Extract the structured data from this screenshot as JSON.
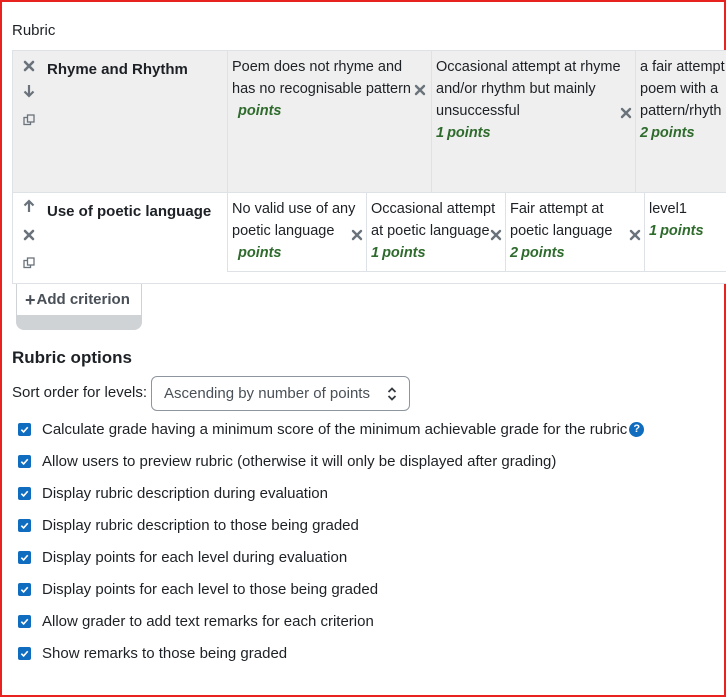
{
  "section_label": "Rubric",
  "criteria": [
    {
      "description": "Rhyme and Rhythm",
      "levels": [
        {
          "definition": [
            "Poem does not rhyme and",
            "has no recognisable pattern"
          ],
          "score": "",
          "points_word": "points"
        },
        {
          "definition": [
            "Occasional attempt at rhyme",
            "and/or rhythm but mainly",
            "unsuccessful"
          ],
          "score": "1",
          "points_word": "points"
        },
        {
          "definition": [
            "a fair attempt",
            "poem with a",
            "pattern/rhyth"
          ],
          "score": "2",
          "points_word": "points"
        }
      ]
    },
    {
      "description": "Use of poetic language",
      "levels": [
        {
          "definition": [
            "No valid use of any",
            "poetic language"
          ],
          "score": "",
          "points_word": "points"
        },
        {
          "definition": [
            "Occasional attempt",
            "at poetic language"
          ],
          "score": "1",
          "points_word": "points"
        },
        {
          "definition": [
            "Fair attempt at",
            "poetic language"
          ],
          "score": "2",
          "points_word": "points"
        },
        {
          "definition": [
            "level1"
          ],
          "score": "1",
          "points_word": "points"
        }
      ]
    }
  ],
  "add_criterion_label": "Add criterion",
  "options": {
    "heading": "Rubric options",
    "sort_label": "Sort order for levels:",
    "sort_value": "Ascending by number of points",
    "checkboxes": [
      {
        "label": "Calculate grade having a minimum score of the minimum achievable grade for the rubric",
        "checked": true,
        "help": true
      },
      {
        "label": "Allow users to preview rubric (otherwise it will only be displayed after grading)",
        "checked": true
      },
      {
        "label": "Display rubric description during evaluation",
        "checked": true
      },
      {
        "label": "Display rubric description to those being graded",
        "checked": true
      },
      {
        "label": "Display points for each level during evaluation",
        "checked": true
      },
      {
        "label": "Display points for each level to those being graded",
        "checked": true
      },
      {
        "label": "Allow grader to add text remarks for each criterion",
        "checked": true
      },
      {
        "label": "Show remarks to those being graded",
        "checked": true
      }
    ]
  },
  "colors": {
    "accent": "#0f6cbf",
    "points_green": "#2e6b2c",
    "frame_red": "#e8231f",
    "row_grey": "#efefef"
  },
  "icons": [
    "delete-icon",
    "move-down-icon",
    "move-up-icon",
    "duplicate-icon",
    "plus-icon",
    "help-icon",
    "sort-arrows-icon",
    "check-icon"
  ]
}
